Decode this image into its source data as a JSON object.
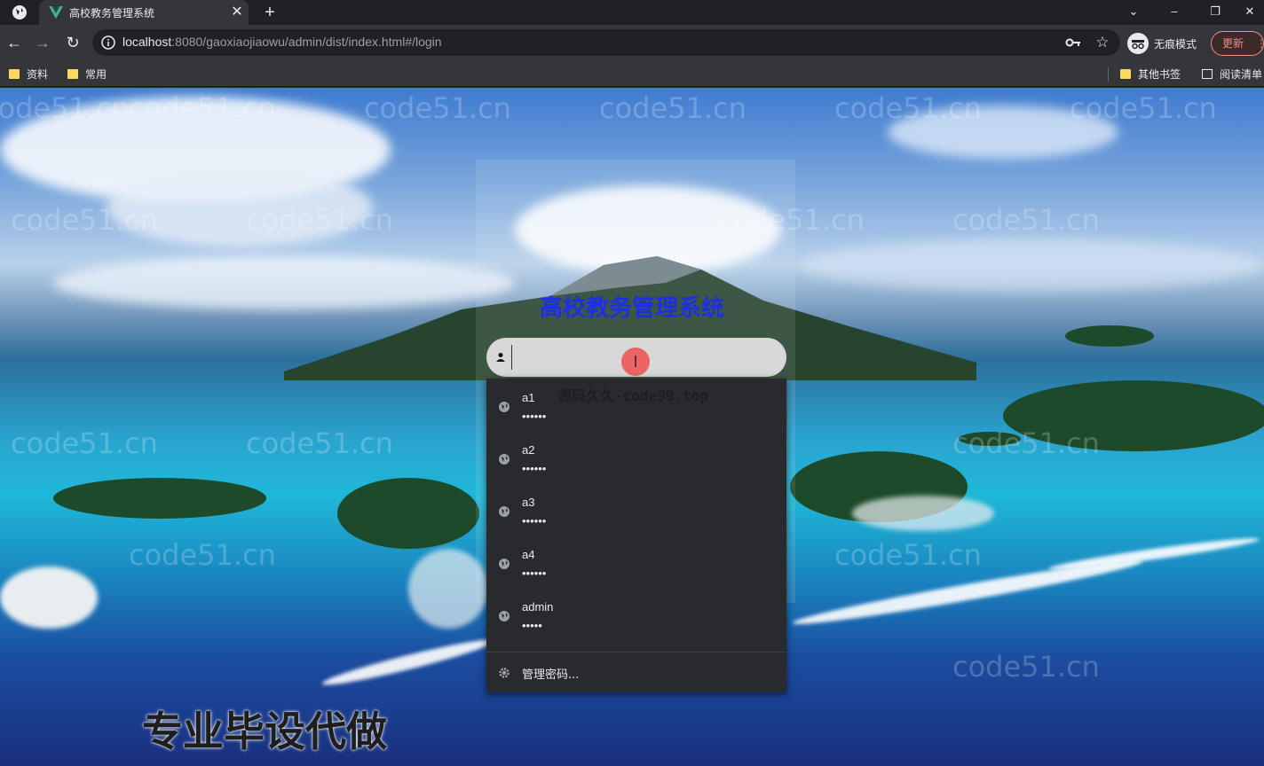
{
  "browser": {
    "tab": {
      "title": "高校教务管理系统",
      "close": "✕"
    },
    "new_tab": "+",
    "window_controls": {
      "dropdown": "⌄",
      "minimize": "–",
      "restore": "❐",
      "close": "✕"
    },
    "nav": {
      "back": "←",
      "forward": "→",
      "reload": "↻"
    },
    "url": {
      "host": "localhost",
      "rest": ":8080/gaoxiaojiaowu/admin/dist/index.html#/login"
    },
    "star": "☆",
    "incognito_label": "无痕模式",
    "update_label": "更新",
    "menu_dots": "⋮",
    "bookmarks": {
      "left": [
        "资料",
        "常用"
      ],
      "other": "其他书签",
      "reading_list": "阅读清单"
    }
  },
  "page": {
    "title": "高校教务管理系统",
    "username_value": "",
    "autofill": [
      {
        "user": "a1",
        "pass": "••••••"
      },
      {
        "user": "a2",
        "pass": "••••••"
      },
      {
        "user": "a3",
        "pass": "••••••"
      },
      {
        "user": "a4",
        "pass": "••••••"
      },
      {
        "user": "admin",
        "pass": "•••••"
      }
    ],
    "manage_passwords": "管理密码...",
    "overlay_text": "源码久久-code99.top",
    "promo_text": "专业毕设代做",
    "watermark": "code51.cn"
  },
  "colors": {
    "title": "#1c2fe6",
    "autofill_bg": "#292a2d",
    "chrome_bg": "#35363a"
  }
}
